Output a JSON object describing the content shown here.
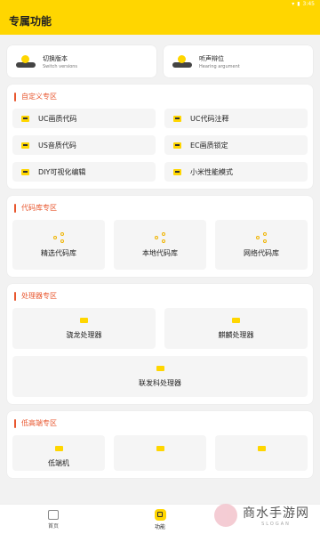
{
  "status_bar": {
    "time": "3:45"
  },
  "app_bar": {
    "title": "专属功能"
  },
  "top_cards": [
    {
      "title": "切换版本",
      "subtitle": "Switch versions",
      "icon": "switch-icon"
    },
    {
      "title": "听声辩位",
      "subtitle": "Hearing argument",
      "icon": "hearing-icon"
    }
  ],
  "custom_section": {
    "title": "自定义专区",
    "items": [
      "UC画质代码",
      "UC代码注释",
      "US音质代码",
      "EC画质锁定",
      "DIY可视化编辑",
      "小米性能模式"
    ]
  },
  "code_section": {
    "title": "代码库专区",
    "items": [
      "精选代码库",
      "本地代码库",
      "网络代码库"
    ]
  },
  "processor_section": {
    "title": "处理器专区",
    "items": [
      "骁龙处理器",
      "麒麟处理器",
      "联发科处理器"
    ]
  },
  "low_section": {
    "title": "低高端专区",
    "items": [
      "低端机",
      "",
      ""
    ]
  },
  "bottom_nav": {
    "home": "首页",
    "function": "功能"
  },
  "watermark": {
    "name": "商水手游网",
    "slogan": "SLOGAN"
  },
  "colors": {
    "accent": "#ffd600",
    "section_title": "#e8562e"
  }
}
